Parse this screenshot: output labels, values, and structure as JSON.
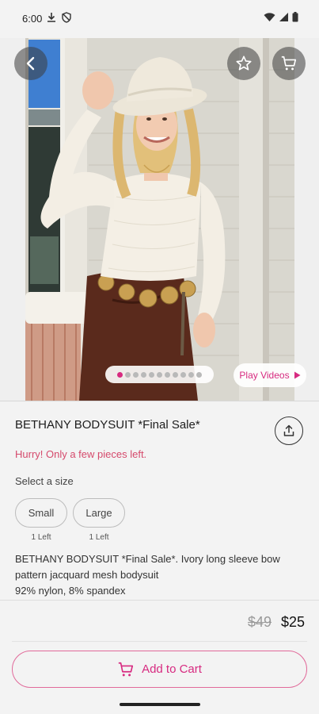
{
  "status_bar": {
    "time": "6:00"
  },
  "product": {
    "title": "BETHANY BODYSUIT *Final Sale*",
    "urgency": "Hurry! Only a few pieces left.",
    "size_prompt": "Select a size",
    "sizes": [
      {
        "label": "Small",
        "stock": "1 Left"
      },
      {
        "label": "Large",
        "stock": "1 Left"
      }
    ],
    "description_line1": "BETHANY BODYSUIT *Final Sale*. Ivory long sleeve bow pattern jacquard mesh bodysuit",
    "description_line2": "92% nylon, 8% spandex",
    "price_original": "$49",
    "price_sale": "$25"
  },
  "gallery": {
    "play_videos_label": "Play Videos",
    "dot_count": 11,
    "active_dot": 0
  },
  "actions": {
    "add_to_cart_label": "Add to Cart"
  },
  "icons": {
    "back": "back-arrow-icon",
    "favorite": "star-outline-icon",
    "cart": "cart-icon",
    "share": "share-icon",
    "play": "play-triangle-icon"
  },
  "colors": {
    "accent": "#d72a80",
    "urgency": "#d54a6c"
  }
}
